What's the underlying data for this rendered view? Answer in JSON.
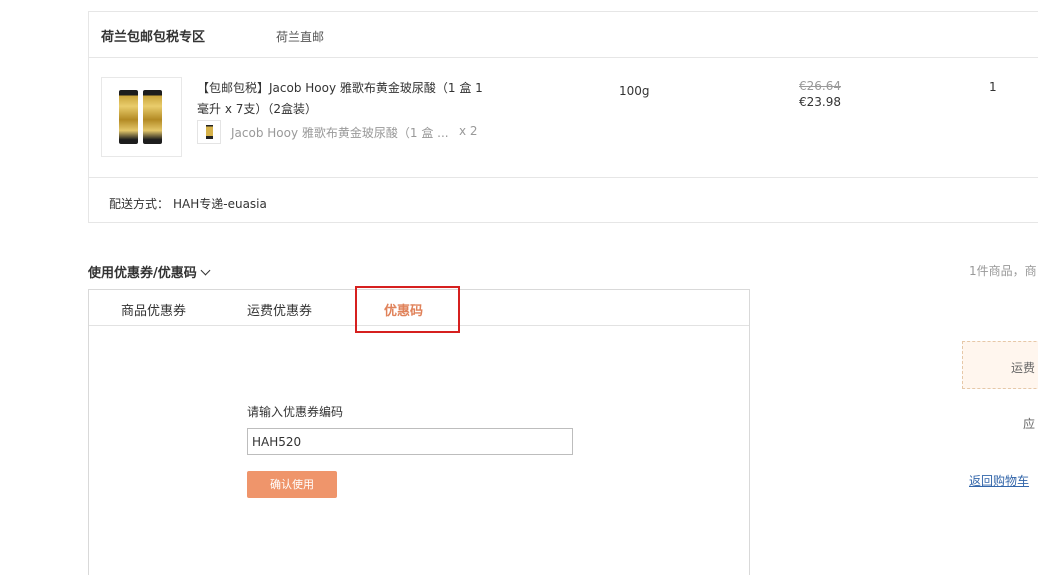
{
  "order": {
    "shop_name": "荷兰包邮包税专区",
    "ship_from": "荷兰直邮",
    "product": {
      "title": "【包邮包税】Jacob Hooy 雅歌布黄金玻尿酸（1 盒 1 毫升 x 7支）（2盒装）",
      "sub_item_name": "Jacob Hooy 雅歌布黄金玻尿酸（1 盒 ...",
      "sub_item_qty": "x 2",
      "spec": "100g",
      "price_original": "€26.64",
      "price_current": "€23.98",
      "quantity": "1"
    },
    "shipping_label": "配送方式：",
    "shipping_value": "HAH专递-euasia"
  },
  "coupon": {
    "title": "使用优惠券/优惠码",
    "tabs": [
      "商品优惠券",
      "运费优惠券",
      "优惠码"
    ],
    "active_tab": "优惠码",
    "code_label": "请输入优惠券编码",
    "code_value": "HAH520",
    "confirm_label": "确认使用",
    "highlight_color": "#d6201f",
    "accent_color": "#e0825a",
    "button_color": "#ef956b"
  },
  "summary": {
    "items_text": "1件商品，商",
    "freight_text": "运费",
    "payable_text": "应",
    "back_link": "返回购物车"
  }
}
